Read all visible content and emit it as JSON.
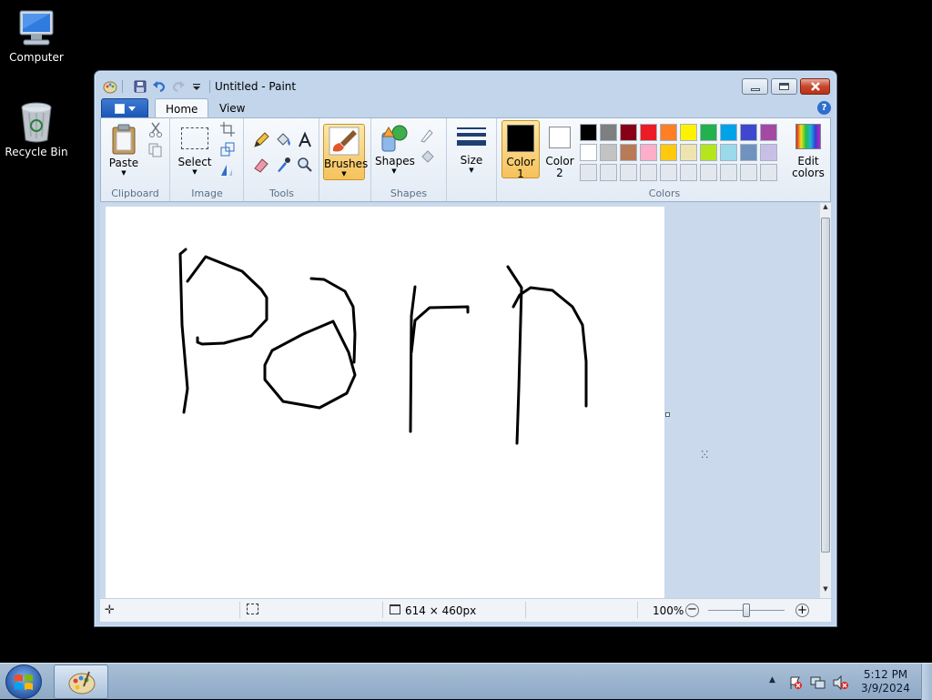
{
  "desktop": {
    "icons": [
      {
        "label": "Computer"
      },
      {
        "label": "Recycle Bin"
      }
    ]
  },
  "window": {
    "title": "Untitled - Paint",
    "tabs": [
      {
        "label": "Home"
      },
      {
        "label": "View"
      }
    ],
    "help_label": "?"
  },
  "ribbon": {
    "clipboard": {
      "paste_label": "Paste",
      "group_label": "Clipboard"
    },
    "image": {
      "select_label": "Select",
      "group_label": "Image"
    },
    "tools": {
      "group_label": "Tools"
    },
    "brushes": {
      "label": "Brushes"
    },
    "shapes": {
      "label": "Shapes",
      "group_label": "Shapes"
    },
    "size": {
      "label": "Size"
    },
    "colors": {
      "color1_line1": "Color",
      "color1_line2": "1",
      "color2_line1": "Color",
      "color2_line2": "2",
      "edit_line1": "Edit",
      "edit_line2": "colors",
      "group_label": "Colors",
      "color1_value": "#000000",
      "color2_value": "#ffffff",
      "palette_row1": [
        "#000000",
        "#7f7f7f",
        "#880015",
        "#ed1c24",
        "#ff7f27",
        "#fff200",
        "#22b14c",
        "#00a2e8",
        "#3f48cc",
        "#a349a4"
      ],
      "palette_row2": [
        "#ffffff",
        "#c3c3c3",
        "#b97a57",
        "#ffaec9",
        "#ffc90e",
        "#efe4b0",
        "#b5e61d",
        "#99d9ea",
        "#7092be",
        "#c8bfe7"
      ],
      "palette_row3": [
        "#e3e8ef",
        "#e3e8ef",
        "#e3e8ef",
        "#e3e8ef",
        "#e3e8ef",
        "#e3e8ef",
        "#e3e8ef",
        "#e3e8ef",
        "#e3e8ef",
        "#e3e8ef"
      ]
    }
  },
  "status": {
    "image_size": "614 × 460px",
    "zoom": "100%"
  },
  "taskbar": {
    "time": "5:12 PM",
    "date": "3/9/2024"
  }
}
